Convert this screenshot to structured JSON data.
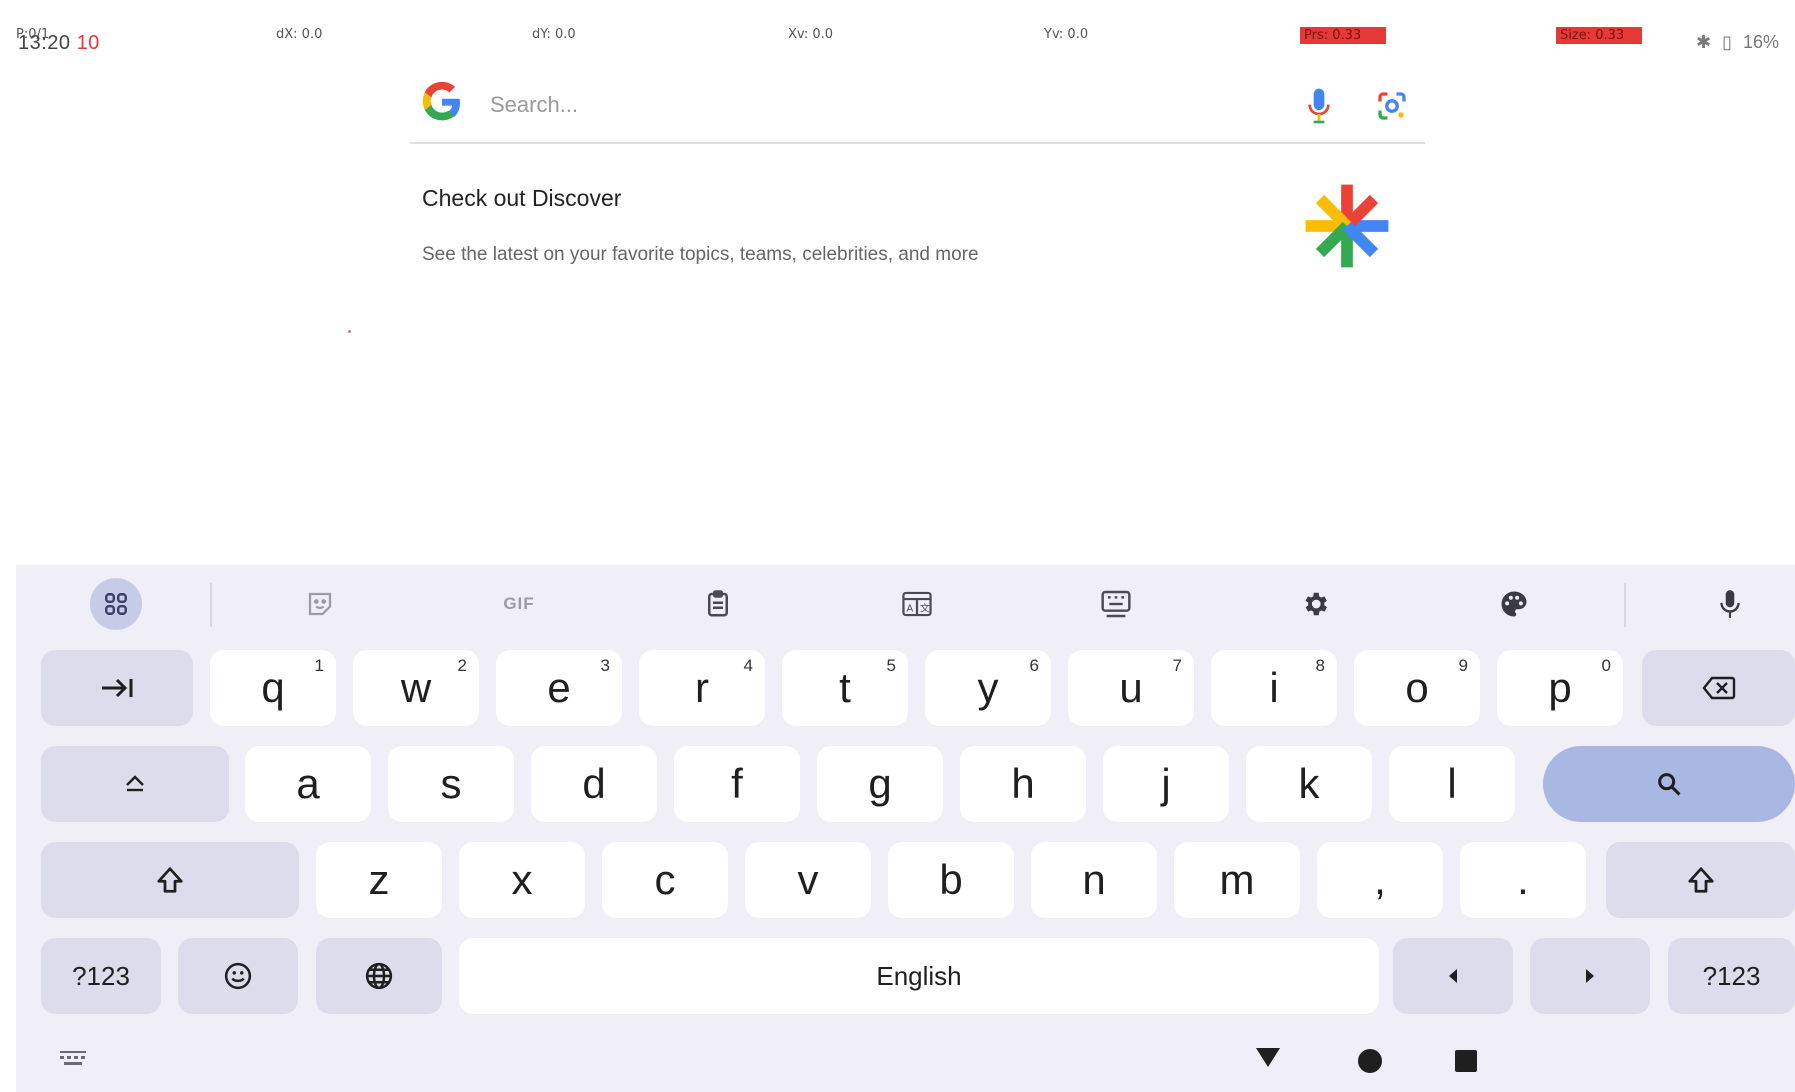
{
  "status_bar": {
    "debug": {
      "pointer": "P:0/1",
      "dx": "dX: 0.0",
      "dy": "dY: 0.0",
      "xv": "Xv: 0.0",
      "yv": "Yv: 0.0",
      "prs": "Prs: 0.33",
      "size": "Size: 0.33"
    },
    "time": "13:20",
    "notification_count": "10",
    "battery": "16%"
  },
  "search": {
    "placeholder": "Search...",
    "colors": {
      "blue": "#4285F4",
      "red": "#EA4335",
      "yellow": "#FBBC05",
      "green": "#34A853"
    }
  },
  "discover": {
    "title": "Check out Discover",
    "subtitle": "See the latest on your favorite topics, teams, celebrities, and more"
  },
  "keyboard": {
    "toolbar": {
      "gif_label": "GIF",
      "icons": [
        "apps-grid-icon",
        "sticker-icon",
        "gif",
        "clipboard-icon",
        "translate-icon",
        "floating-keyboard-icon",
        "settings-icon",
        "palette-icon",
        "microphone-icon"
      ]
    },
    "row1": [
      {
        "label": "q",
        "hint": "1"
      },
      {
        "label": "w",
        "hint": "2"
      },
      {
        "label": "e",
        "hint": "3"
      },
      {
        "label": "r",
        "hint": "4"
      },
      {
        "label": "t",
        "hint": "5"
      },
      {
        "label": "y",
        "hint": "6"
      },
      {
        "label": "u",
        "hint": "7"
      },
      {
        "label": "i",
        "hint": "8"
      },
      {
        "label": "o",
        "hint": "9"
      },
      {
        "label": "p",
        "hint": "0"
      }
    ],
    "row2": [
      "a",
      "s",
      "d",
      "f",
      "g",
      "h",
      "j",
      "k",
      "l"
    ],
    "row3": [
      "z",
      "x",
      "c",
      "v",
      "b",
      "n",
      "m",
      ",",
      "."
    ],
    "symbols_label": "?123",
    "space_label": "English",
    "accent_color": "#a9b7e3"
  }
}
